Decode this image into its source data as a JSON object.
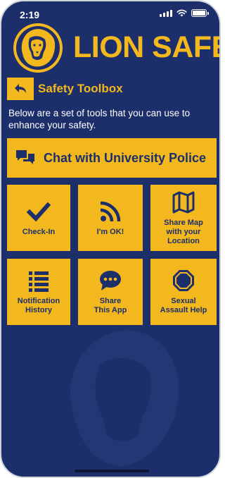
{
  "status_bar": {
    "time": "2:19",
    "icons": [
      "cellular-signal-icon",
      "wifi-icon",
      "battery-icon"
    ]
  },
  "header": {
    "app_name": "LION SAFE",
    "logo_icon": "lion-head-logo-icon"
  },
  "toolbox": {
    "back_icon": "back-arrow-icon",
    "title": "Safety Toolbox",
    "description": "Below are a set of tools that you can use to enhance your safety."
  },
  "chat_button": {
    "label": "Chat with University Police",
    "icon": "chat-bubbles-icon"
  },
  "tiles": [
    {
      "label": "Check-In",
      "icon": "checkmark-icon"
    },
    {
      "label": "I'm OK!",
      "icon": "rss-feed-icon"
    },
    {
      "label": "Share Map\nwith your\nLocation",
      "icon": "map-icon"
    },
    {
      "label": "Notification\nHistory",
      "icon": "list-icon"
    },
    {
      "label": "Share\nThis App",
      "icon": "speech-bubble-icon"
    },
    {
      "label": "Sexual\nAssault Help",
      "icon": "octagon-icon"
    }
  ],
  "colors": {
    "background": "#1d2f6b",
    "accent": "#f3b81d",
    "text_dark": "#1d2f6b"
  }
}
